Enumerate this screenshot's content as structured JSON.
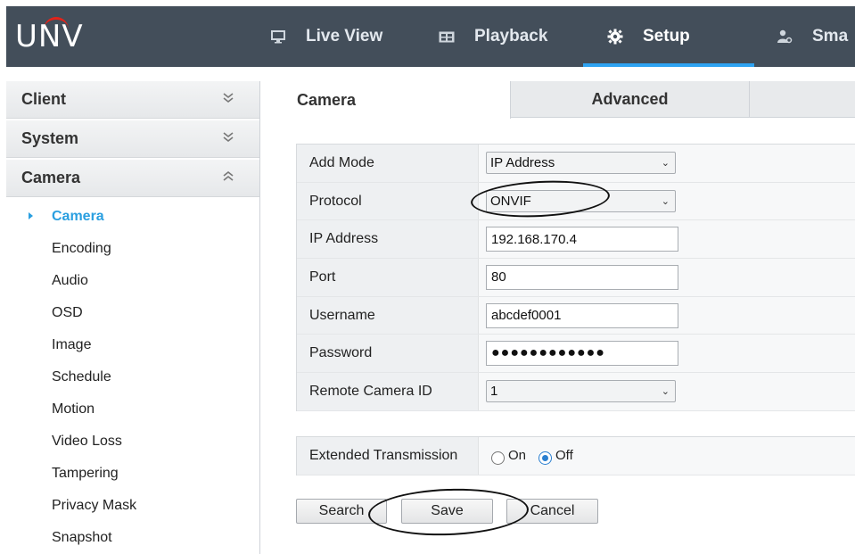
{
  "header": {
    "logo": "UNV",
    "nav": [
      {
        "label": "Live View",
        "icon": "monitor-icon"
      },
      {
        "label": "Playback",
        "icon": "film-icon"
      },
      {
        "label": "Setup",
        "icon": "gear-icon"
      },
      {
        "label": "Sma",
        "icon": "user-icon"
      }
    ],
    "accent_color": "#2ea3f2",
    "bar_color": "#434e5a"
  },
  "sidebar": {
    "sections": [
      {
        "label": "Client",
        "icon": "chevron-double-down-icon"
      },
      {
        "label": "System",
        "icon": "chevron-double-down-icon"
      },
      {
        "label": "Camera",
        "icon": "chevron-double-up-icon"
      }
    ],
    "items": [
      {
        "label": "Camera"
      },
      {
        "label": "Encoding"
      },
      {
        "label": "Audio"
      },
      {
        "label": "OSD"
      },
      {
        "label": "Image"
      },
      {
        "label": "Schedule"
      },
      {
        "label": "Motion"
      },
      {
        "label": "Video Loss"
      },
      {
        "label": "Tampering"
      },
      {
        "label": "Privacy Mask"
      },
      {
        "label": "Snapshot"
      }
    ],
    "active_color": "#2a9fe0"
  },
  "tabs": [
    {
      "label": "Camera"
    },
    {
      "label": "Advanced"
    }
  ],
  "form": {
    "add_mode": {
      "label": "Add Mode",
      "value": "IP Address"
    },
    "protocol": {
      "label": "Protocol",
      "value": "ONVIF"
    },
    "ip_address": {
      "label": "IP Address",
      "value": "192.168.170.4"
    },
    "port": {
      "label": "Port",
      "value": "80"
    },
    "username": {
      "label": "Username",
      "value": "abcdef0001"
    },
    "password": {
      "label": "Password",
      "value": "●●●●●●●●●●●●"
    },
    "remote_camera_id": {
      "label": "Remote Camera ID",
      "value": "1"
    }
  },
  "extended": {
    "label": "Extended Transmission",
    "on_label": "On",
    "off_label": "Off",
    "selected": "Off"
  },
  "buttons": {
    "search": "Search",
    "save": "Save",
    "cancel": "Cancel"
  }
}
